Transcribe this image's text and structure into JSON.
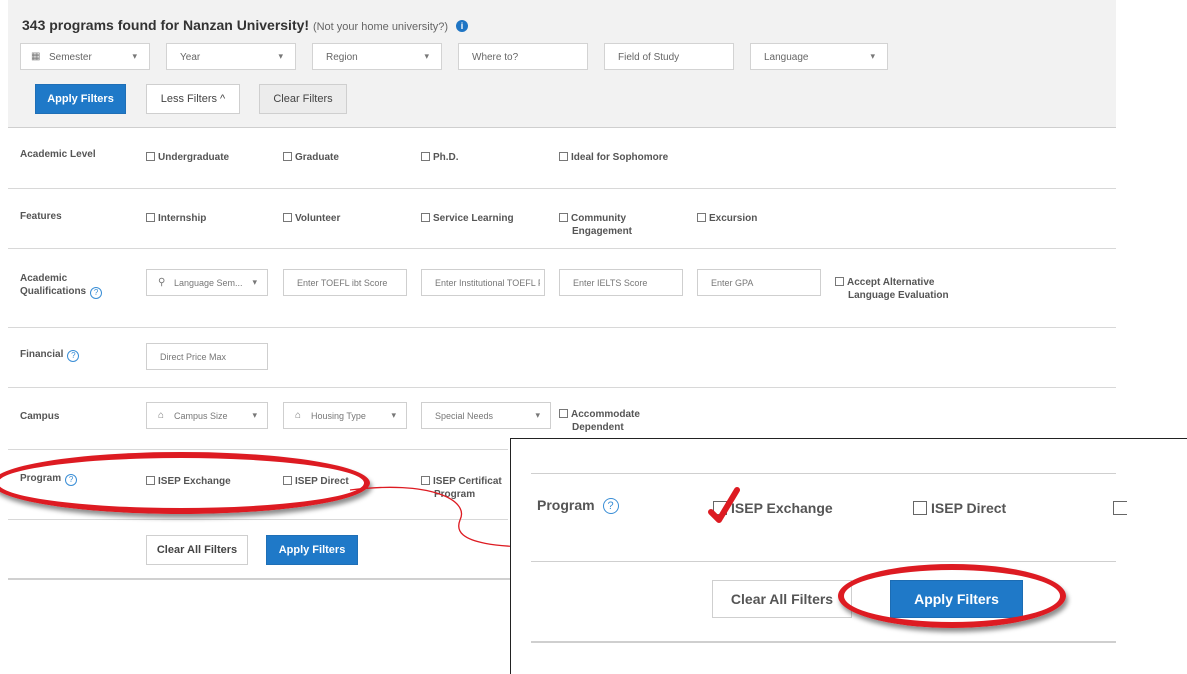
{
  "header": {
    "results_text": "343 programs found for Nanzan University!",
    "not_home_text": "(Not your home university?)",
    "info_icon": "i",
    "filters": {
      "semester": "Semester",
      "year": "Year",
      "region": "Region",
      "where_to": "Where to?",
      "field_of_study": "Field of Study",
      "language": "Language"
    },
    "apply_filters": "Apply Filters",
    "less_filters": "Less Filters ^",
    "clear_filters": "Clear Filters"
  },
  "sections": {
    "academic_level": {
      "label": "Academic Level",
      "options": [
        "Undergraduate",
        "Graduate",
        "Ph.D.",
        "Ideal for Sophomore"
      ]
    },
    "features": {
      "label": "Features",
      "options": [
        "Internship",
        "Volunteer",
        "Service Learning",
        "Community",
        "Engagement",
        "Excursion"
      ]
    },
    "academic_qualifications": {
      "label_line1": "Academic",
      "label_line2": "Qualifications",
      "language_semester": "Language Sem...",
      "toefl_ibt": "Enter TOEFL ibt Score",
      "institutional_toefl": "Enter Institutional TOEFL P",
      "ielts": "Enter IELTS Score",
      "gpa": "Enter GPA",
      "accept_alt_line1": "Accept Alternative",
      "accept_alt_line2": "Language Evaluation"
    },
    "financial": {
      "label": "Financial",
      "direct_price_max": "Direct Price Max"
    },
    "campus": {
      "label": "Campus",
      "campus_size": "Campus Size",
      "housing_type": "Housing Type",
      "special_needs": "Special Needs",
      "accommodate_line1": "Accommodate",
      "accommodate_line2": "Dependent"
    },
    "program": {
      "label": "Program",
      "isep_exchange": "ISEP Exchange",
      "isep_direct": "ISEP Direct",
      "isep_cert_line1": "ISEP Certificat",
      "isep_cert_line2": "Program"
    }
  },
  "footer": {
    "clear_all": "Clear All Filters",
    "apply": "Apply Filters"
  },
  "zoom": {
    "program_label": "Program",
    "isep_exchange": "ISEP Exchange",
    "isep_direct": "ISEP Direct",
    "clear_all": "Clear All Filters",
    "apply": "Apply Filters"
  },
  "help_glyph": "?",
  "chevron_glyph": "▾",
  "colors": {
    "accent_blue": "#1f79c8",
    "annotation_red": "#dd1b22",
    "header_bg": "#f2f2f2"
  }
}
